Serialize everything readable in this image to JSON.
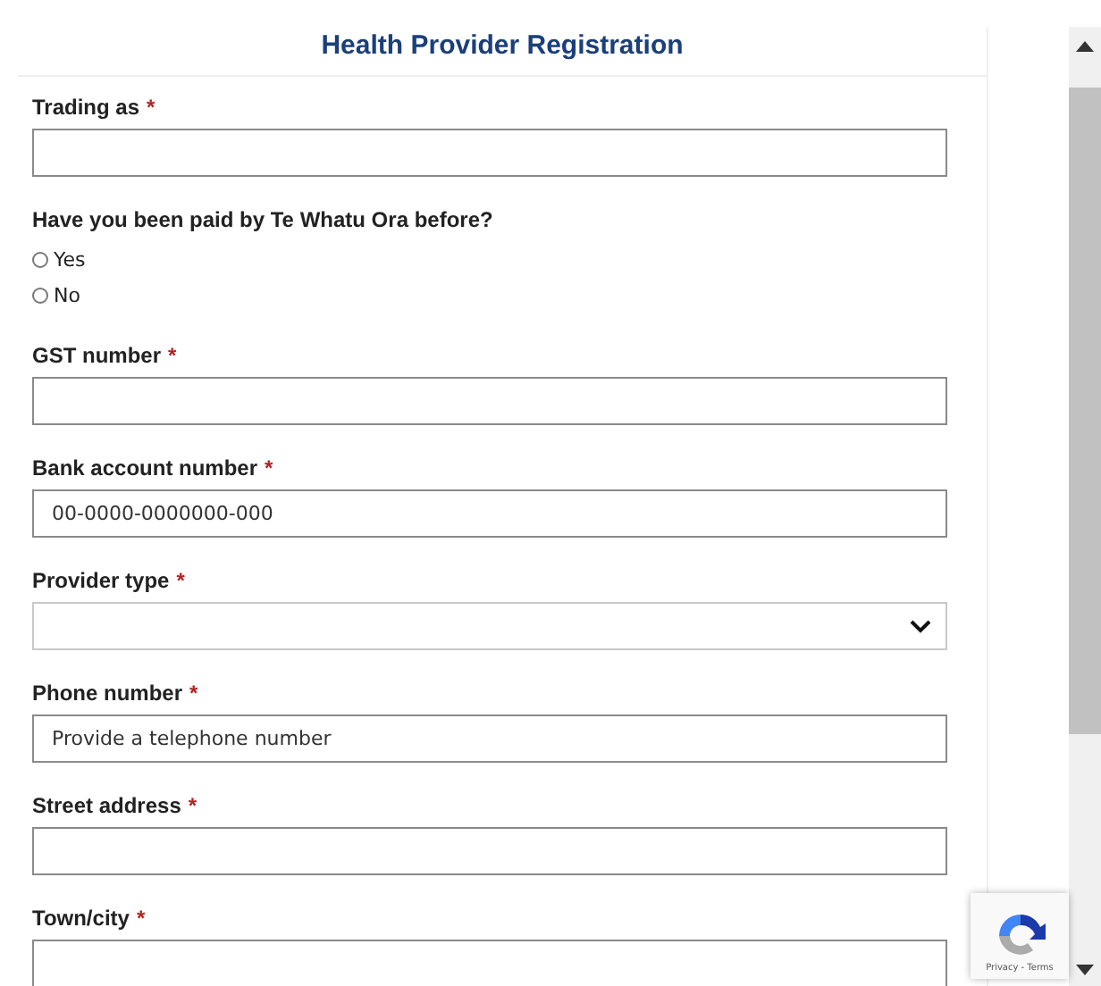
{
  "form": {
    "title": "Health Provider Registration",
    "fields": [
      {
        "kind": "text",
        "label": "Trading as",
        "marker": "*"
      },
      {
        "kind": "radio",
        "label": "Have you been paid by Te Whatu Ora before?",
        "options": [
          {
            "label": "Yes",
            "selected": false
          },
          {
            "label": "No",
            "selected": false
          }
        ]
      },
      {
        "kind": "text",
        "label": "GST number",
        "marker": "*"
      },
      {
        "kind": "text",
        "label": "Bank account number",
        "marker": "*",
        "placeholder": "00-0000-0000000-000"
      },
      {
        "kind": "select",
        "label": "Provider type",
        "marker": "*"
      },
      {
        "kind": "text",
        "label": "Phone number",
        "marker": "*",
        "placeholder": "Provide a telephone number"
      },
      {
        "kind": "text",
        "label": "Street address",
        "marker": "*"
      },
      {
        "kind": "text",
        "label": "Town/city",
        "marker": "*"
      }
    ]
  },
  "recaptcha": {
    "links": "Privacy - Terms"
  }
}
